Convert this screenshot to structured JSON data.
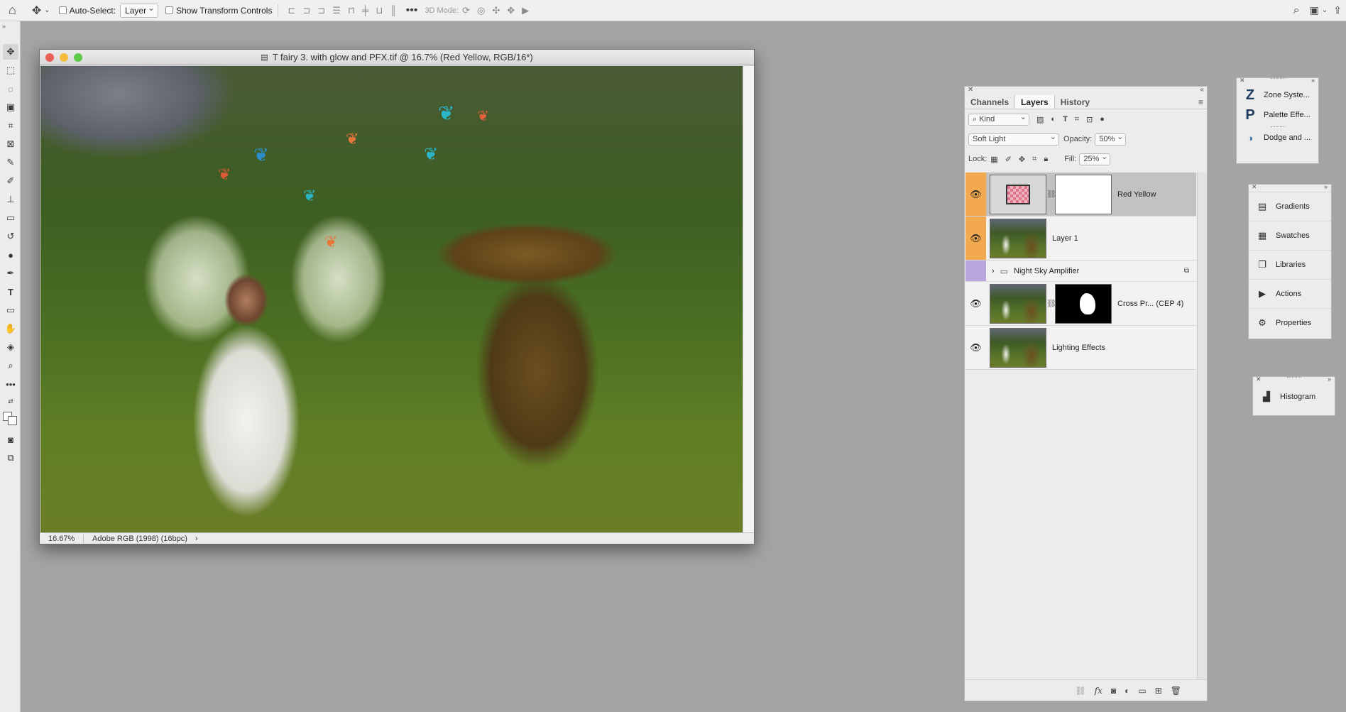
{
  "options_bar": {
    "auto_select_label": "Auto-Select:",
    "auto_select_value": "Layer",
    "show_transform_label": "Show Transform Controls",
    "mode_3d_label": "3D Mode:"
  },
  "document": {
    "title": "T fairy 3. with glow and PFX.tif @ 16.7% (Red Yellow, RGB/16*)",
    "zoom": "16.67%",
    "color_profile": "Adobe RGB (1998) (16bpc)"
  },
  "layers_panel": {
    "tabs": [
      "Channels",
      "Layers",
      "History"
    ],
    "filter_kind": "Kind",
    "blend_mode": "Soft Light",
    "opacity_label": "Opacity:",
    "opacity_value": "50%",
    "lock_label": "Lock:",
    "fill_label": "Fill:",
    "fill_value": "25%",
    "layers": [
      {
        "name": "Red Yellow",
        "selected": true
      },
      {
        "name": "Layer 1",
        "selected": false
      },
      {
        "name": "Night Sky Amplifier",
        "type": "group"
      },
      {
        "name": "Cross Pr... (CEP 4)",
        "selected": false
      },
      {
        "name": "Lighting Effects",
        "selected": false
      }
    ]
  },
  "plugin_panel": {
    "items": [
      "Zone Syste...",
      "Palette Effe...",
      "Dodge and ..."
    ]
  },
  "docked_panel": {
    "items": [
      "Gradients",
      "Swatches",
      "Libraries",
      "Actions",
      "Properties"
    ]
  },
  "histogram_panel": {
    "label": "Histogram"
  },
  "colors": {
    "layer_highlight": "#f3a94f",
    "group_highlight": "#b9a6de",
    "selected_row": "#c2c2c2",
    "workspace": "#a4a4a4"
  }
}
